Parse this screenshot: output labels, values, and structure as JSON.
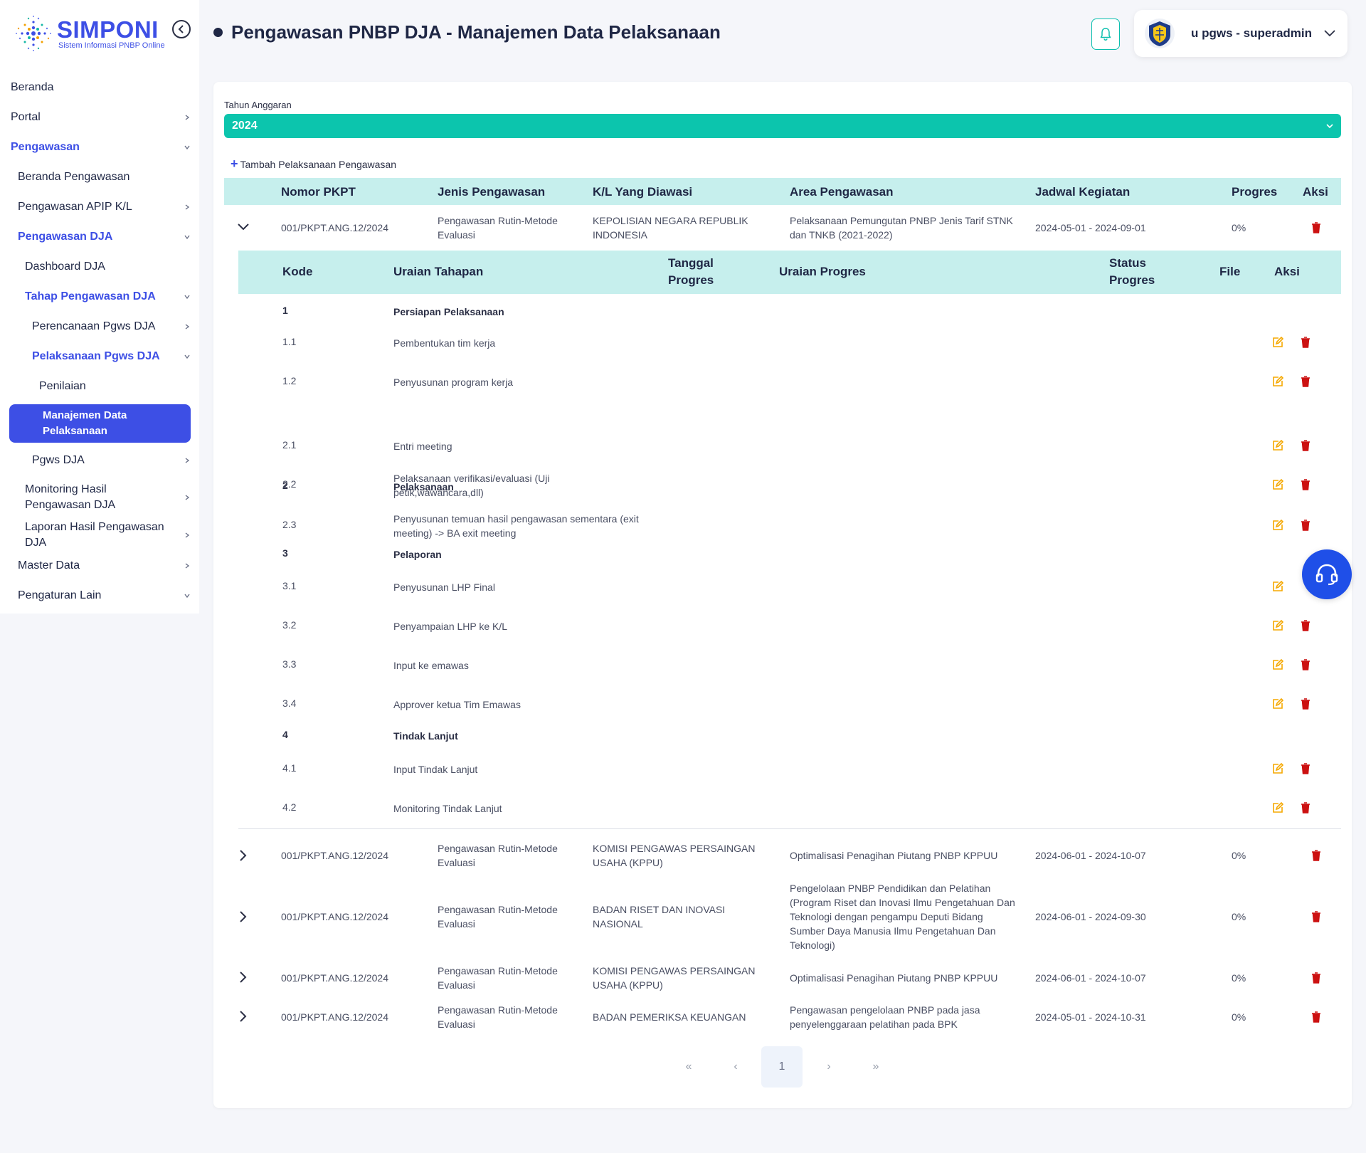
{
  "brand": {
    "name": "SIMPONI",
    "tagline": "Sistem Informasi PNBP Online"
  },
  "sidebar": {
    "items": [
      {
        "label": "Beranda"
      },
      {
        "label": "Portal"
      },
      {
        "label": "Pengawasan"
      },
      {
        "label": "Beranda Pengawasan"
      },
      {
        "label": "Pengawasan APIP K/L"
      },
      {
        "label": "Pengawasan DJA"
      },
      {
        "label": "Dashboard DJA"
      },
      {
        "label": "Tahap Pengawasan DJA"
      },
      {
        "label": "Perencanaan Pgws DJA"
      },
      {
        "label": "Pelaksanaan Pgws DJA"
      },
      {
        "label": "Penilaian"
      },
      {
        "label": "Manajemen Data Pelaksanaan"
      },
      {
        "label": "Pgws DJA"
      },
      {
        "label": "Monitoring Hasil Pengawasan DJA"
      },
      {
        "label": "Laporan Hasil Pengawasan DJA"
      },
      {
        "label": "Master Data"
      },
      {
        "label": "Pengaturan Lain"
      }
    ]
  },
  "header": {
    "title": "Pengawasan PNBP DJA - Manajemen Data Pelaksanaan",
    "user": "u pgws - superadmin"
  },
  "filter": {
    "label": "Tahun Anggaran",
    "value": "2024"
  },
  "add_label": "Tambah Pelaksanaan Pengawasan",
  "table": {
    "columns": [
      "Nomor PKPT",
      "Jenis Pengawasan",
      "K/L Yang Diawasi",
      "Area Pengawasan",
      "Jadwal Kegiatan",
      "Progres",
      "Aksi"
    ],
    "rows": [
      {
        "nomor": "001/PKPT.ANG.12/2024",
        "jenis": "Pengawasan Rutin-Metode Evaluasi",
        "kl": "KEPOLISIAN NEGARA REPUBLIK INDONESIA",
        "area": "Pelaksanaan Pemungutan PNBP Jenis Tarif STNK dan TNKB (2021-2022)",
        "jadwal": "2024-05-01 - 2024-09-01",
        "progres": "0%"
      },
      {
        "nomor": "001/PKPT.ANG.12/2024",
        "jenis": "Pengawasan Rutin-Metode Evaluasi",
        "kl": "KOMISI PENGAWAS PERSAINGAN USAHA (KPPU)",
        "area": "Optimalisasi Penagihan Piutang PNBP KPPUU",
        "jadwal": "2024-06-01 - 2024-10-07",
        "progres": "0%"
      },
      {
        "nomor": "001/PKPT.ANG.12/2024",
        "jenis": "Pengawasan Rutin-Metode Evaluasi",
        "kl": "BADAN RISET DAN INOVASI NASIONAL",
        "area": "Pengelolaan PNBP Pendidikan dan Pelatihan (Program Riset dan Inovasi Ilmu Pengetahuan Dan Teknologi dengan pengampu Deputi Bidang Sumber Daya Manusia Ilmu Pengetahuan Dan Teknologi)",
        "jadwal": "2024-06-01 - 2024-09-30",
        "progres": "0%"
      },
      {
        "nomor": "001/PKPT.ANG.12/2024",
        "jenis": "Pengawasan Rutin-Metode Evaluasi",
        "kl": "KOMISI PENGAWAS PERSAINGAN USAHA (KPPU)",
        "area": "Optimalisasi Penagihan Piutang PNBP KPPUU",
        "jadwal": "2024-06-01 - 2024-10-07",
        "progres": "0%"
      },
      {
        "nomor": "001/PKPT.ANG.12/2024",
        "jenis": "Pengawasan Rutin-Metode Evaluasi",
        "kl": "BADAN PEMERIKSA KEUANGAN",
        "area": "Pengawasan pengelolaan PNBP pada jasa penyelenggaraan pelatihan pada BPK",
        "jadwal": "2024-05-01 - 2024-10-31",
        "progres": "0%"
      }
    ]
  },
  "subtable": {
    "columns": [
      "Kode",
      "Uraian Tahapan",
      "Tanggal Progres",
      "Uraian Progres",
      "Status Progres",
      "File",
      "Aksi"
    ],
    "rows": [
      {
        "code": "1",
        "desc": "Persiapan Pelaksanaan",
        "group": true
      },
      {
        "code": "1.1",
        "desc": "Pembentukan tim kerja"
      },
      {
        "code": "1.2",
        "desc": "Penyusunan program kerja"
      },
      {
        "code": "2",
        "desc": "Pelaksanaan",
        "group": true
      },
      {
        "code": "2.1",
        "desc": "Entri meeting"
      },
      {
        "code": "2.2",
        "desc": "Pelaksanaan verifikasi/evaluasi (Uji petik,wawancara,dll)"
      },
      {
        "code": "2.3",
        "desc": "Penyusunan temuan hasil pengawasan sementara (exit meeting) -> BA exit meeting"
      },
      {
        "code": "3",
        "desc": "Pelaporan",
        "group": true
      },
      {
        "code": "3.1",
        "desc": "Penyusunan LHP Final"
      },
      {
        "code": "3.2",
        "desc": "Penyampaian LHP ke K/L"
      },
      {
        "code": "3.3",
        "desc": "Input ke emawas"
      },
      {
        "code": "3.4",
        "desc": "Approver ketua Tim Emawas"
      },
      {
        "code": "4",
        "desc": "Tindak Lanjut",
        "group": true
      },
      {
        "code": "4.1",
        "desc": "Input Tindak Lanjut"
      },
      {
        "code": "4.2",
        "desc": "Monitoring Tindak Lanjut"
      }
    ]
  },
  "pagination": {
    "first": "«",
    "prev": "‹",
    "current": "1",
    "next": "›",
    "last": "»"
  },
  "icons": [
    "collapse-icon",
    "chevron-icon",
    "bell-icon",
    "emblem-icon",
    "trash-icon",
    "edit-icon",
    "headset-icon"
  ],
  "colors": {
    "accent": "#3d4fe5",
    "teal": "#0cc5ad",
    "header_bg": "#c6efed",
    "danger": "#cc1111",
    "edit": "#f5a800"
  }
}
